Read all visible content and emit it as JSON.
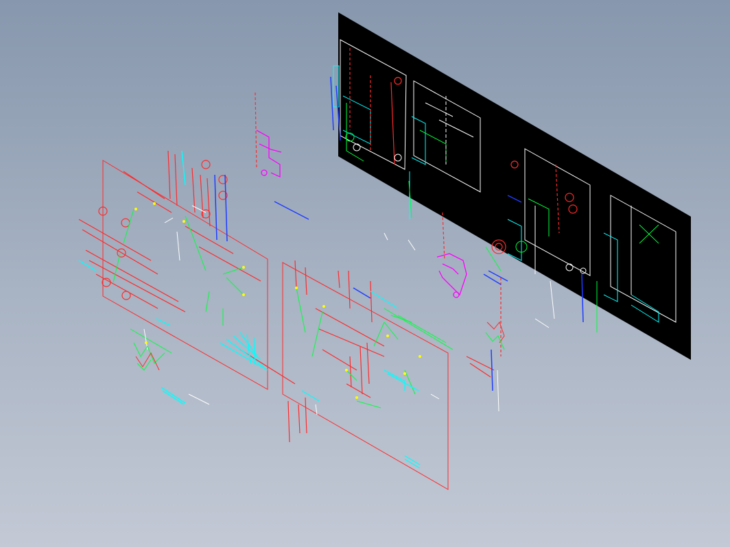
{
  "view": {
    "background_top": "#8797ad",
    "background_bottom": "#c3c9d5"
  },
  "palette": {
    "frame_red": "#ff2a2a",
    "sheet_black": "#000000",
    "line_white": "#ffffff",
    "line_cyan": "#00ffff",
    "line_green": "#00ff3c",
    "line_blue": "#1e3cff",
    "line_magenta": "#ff00ff",
    "line_yellow": "#ffff00"
  },
  "layers": [
    {
      "name": "black-drawing-sheet",
      "fill": "#000000",
      "label": ""
    },
    {
      "name": "drawing-frame-left",
      "stroke": "#ff2a2a",
      "label": ""
    },
    {
      "name": "drawing-frame-right",
      "stroke": "#ff2a2a",
      "label": ""
    }
  ]
}
